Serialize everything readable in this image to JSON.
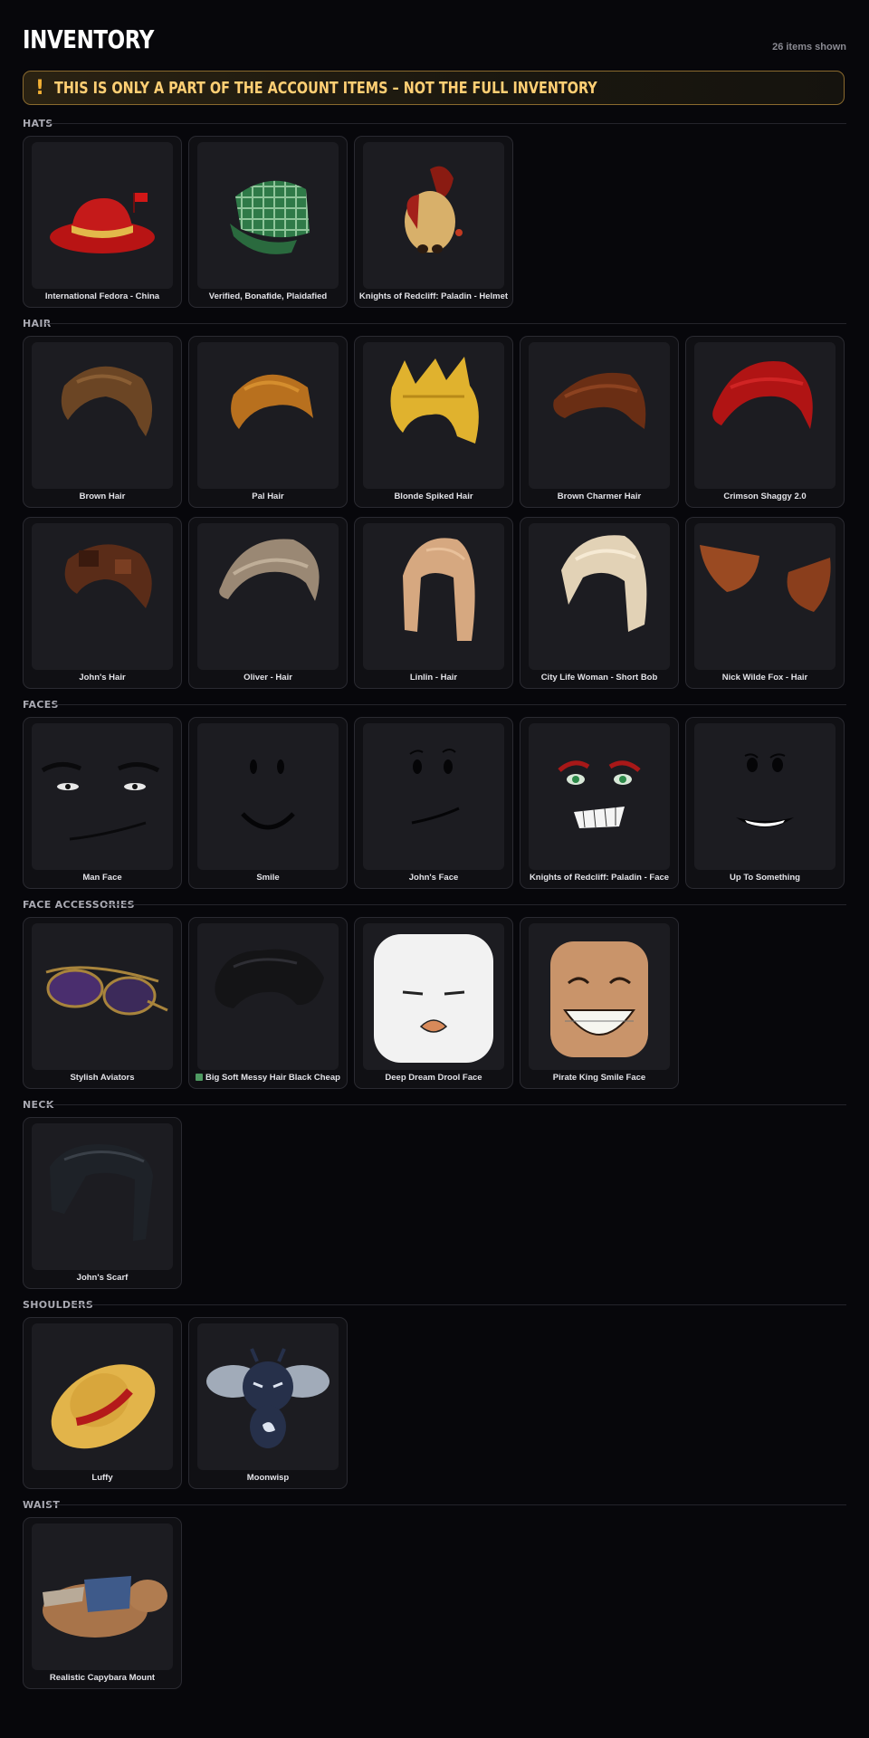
{
  "header": {
    "title": "INVENTORY",
    "count": "26 items shown",
    "warning_icon": "!",
    "warning": "THIS IS ONLY A PART OF THE ACCOUNT ITEMS – NOT THE FULL INVENTORY"
  },
  "sections": {
    "hats": {
      "label": "HATS",
      "items": [
        "International Fedora - China",
        "Verified, Bonafide, Plaidafied",
        "Knights of Redcliff: Paladin - Helmet"
      ]
    },
    "hair": {
      "label": "HAIR",
      "items": [
        "Brown Hair",
        "Pal Hair",
        "Blonde Spiked Hair",
        "Brown Charmer Hair",
        "Crimson Shaggy 2.0",
        "John's Hair",
        "Oliver - Hair",
        "Linlin - Hair",
        "City Life Woman - Short Bob",
        "Nick Wilde Fox - Hair"
      ]
    },
    "faces": {
      "label": "FACES",
      "items": [
        "Man Face",
        "Smile",
        "John's Face",
        "Knights of Redcliff: Paladin - Face",
        "Up To Something"
      ]
    },
    "face_accessories": {
      "label": "FACE ACCESSORIES",
      "items": [
        "Stylish Aviators",
        "Big Soft Messy Hair Black Cheap",
        "Deep Dream Drool Face",
        "Pirate King Smile Face"
      ]
    },
    "neck": {
      "label": "NECK",
      "items": [
        "John's Scarf"
      ]
    },
    "shoulders": {
      "label": "SHOULDERS",
      "items": [
        "Luffy",
        "Moonwisp"
      ]
    },
    "waist": {
      "label": "WAIST",
      "items": [
        "Realistic Capybara Mount"
      ]
    }
  },
  "colors": {
    "background": "#07070b",
    "card": "#101014",
    "thumb": "#1c1c21",
    "warning_border": "#8a6a2e",
    "warning_text": "#ffcf74",
    "warning_icon": "#f2b034"
  }
}
